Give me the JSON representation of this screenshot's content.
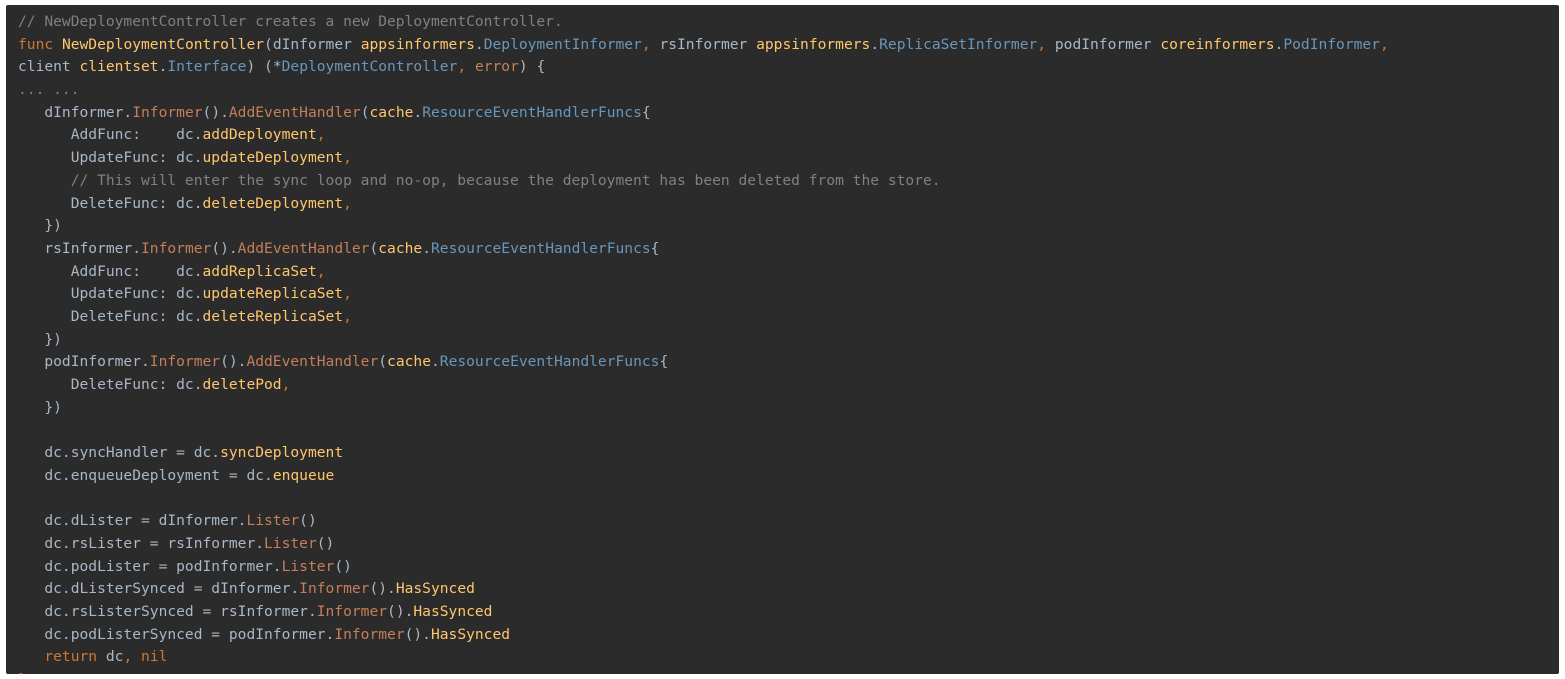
{
  "theme": {
    "background": "#2b2b2b",
    "plain": "#a9b7c6",
    "comment": "#808080",
    "keyword": "#cc7832",
    "function": "#ffc66d",
    "type": "#6897bb",
    "method": "#c57e59"
  },
  "code": {
    "lines": [
      [
        [
          "// NewDeploymentController creates a new DeploymentController.",
          "comment"
        ]
      ],
      [
        [
          "func ",
          "keyword"
        ],
        [
          "NewDeploymentController",
          "function"
        ],
        [
          "(dInformer ",
          "plain"
        ],
        [
          "appsinformers",
          "function"
        ],
        [
          ".",
          "plain"
        ],
        [
          "DeploymentInformer",
          "type"
        ],
        [
          ", ",
          "keyword"
        ],
        [
          "rsInformer ",
          "plain"
        ],
        [
          "appsinformers",
          "function"
        ],
        [
          ".",
          "plain"
        ],
        [
          "ReplicaSetInformer",
          "type"
        ],
        [
          ", ",
          "keyword"
        ],
        [
          "podInformer ",
          "plain"
        ],
        [
          "coreinformers",
          "function"
        ],
        [
          ".",
          "plain"
        ],
        [
          "PodInformer",
          "type"
        ],
        [
          ",",
          "keyword"
        ]
      ],
      [
        [
          "client ",
          "plain"
        ],
        [
          "clientset",
          "function"
        ],
        [
          ".",
          "plain"
        ],
        [
          "Interface",
          "type"
        ],
        [
          ") (*",
          "plain"
        ],
        [
          "DeploymentController",
          "type"
        ],
        [
          ", ",
          "keyword"
        ],
        [
          "error",
          "method"
        ],
        [
          ") {",
          "plain"
        ]
      ],
      [
        [
          "... ...",
          "comment"
        ]
      ],
      [
        [
          "   dInformer.",
          "plain"
        ],
        [
          "Informer",
          "method"
        ],
        [
          "().",
          "plain"
        ],
        [
          "AddEventHandler",
          "method"
        ],
        [
          "(",
          "plain"
        ],
        [
          "cache",
          "function"
        ],
        [
          ".",
          "plain"
        ],
        [
          "ResourceEventHandlerFuncs",
          "type"
        ],
        [
          "{",
          "plain"
        ]
      ],
      [
        [
          "      AddFunc:    dc.",
          "plain"
        ],
        [
          "addDeployment",
          "function"
        ],
        [
          ",",
          "keyword"
        ]
      ],
      [
        [
          "      UpdateFunc: dc.",
          "plain"
        ],
        [
          "updateDeployment",
          "function"
        ],
        [
          ",",
          "keyword"
        ]
      ],
      [
        [
          "      // This will enter the sync loop and no-op, because the deployment has been deleted from the store.",
          "comment"
        ]
      ],
      [
        [
          "      DeleteFunc: dc.",
          "plain"
        ],
        [
          "deleteDeployment",
          "function"
        ],
        [
          ",",
          "keyword"
        ]
      ],
      [
        [
          "   })",
          "plain"
        ]
      ],
      [
        [
          "   rsInformer.",
          "plain"
        ],
        [
          "Informer",
          "method"
        ],
        [
          "().",
          "plain"
        ],
        [
          "AddEventHandler",
          "method"
        ],
        [
          "(",
          "plain"
        ],
        [
          "cache",
          "function"
        ],
        [
          ".",
          "plain"
        ],
        [
          "ResourceEventHandlerFuncs",
          "type"
        ],
        [
          "{",
          "plain"
        ]
      ],
      [
        [
          "      AddFunc:    dc.",
          "plain"
        ],
        [
          "addReplicaSet",
          "function"
        ],
        [
          ",",
          "keyword"
        ]
      ],
      [
        [
          "      UpdateFunc: dc.",
          "plain"
        ],
        [
          "updateReplicaSet",
          "function"
        ],
        [
          ",",
          "keyword"
        ]
      ],
      [
        [
          "      DeleteFunc: dc.",
          "plain"
        ],
        [
          "deleteReplicaSet",
          "function"
        ],
        [
          ",",
          "keyword"
        ]
      ],
      [
        [
          "   })",
          "plain"
        ]
      ],
      [
        [
          "   podInformer.",
          "plain"
        ],
        [
          "Informer",
          "method"
        ],
        [
          "().",
          "plain"
        ],
        [
          "AddEventHandler",
          "method"
        ],
        [
          "(",
          "plain"
        ],
        [
          "cache",
          "function"
        ],
        [
          ".",
          "plain"
        ],
        [
          "ResourceEventHandlerFuncs",
          "type"
        ],
        [
          "{",
          "plain"
        ]
      ],
      [
        [
          "      DeleteFunc: dc.",
          "plain"
        ],
        [
          "deletePod",
          "function"
        ],
        [
          ",",
          "keyword"
        ]
      ],
      [
        [
          "   })",
          "plain"
        ]
      ],
      [
        [
          "",
          "plain"
        ]
      ],
      [
        [
          "   dc.syncHandler = dc.",
          "plain"
        ],
        [
          "syncDeployment",
          "function"
        ]
      ],
      [
        [
          "   dc.enqueueDeployment = dc.",
          "plain"
        ],
        [
          "enqueue",
          "function"
        ]
      ],
      [
        [
          "",
          "plain"
        ]
      ],
      [
        [
          "   dc.dLister = dInformer.",
          "plain"
        ],
        [
          "Lister",
          "method"
        ],
        [
          "()",
          "plain"
        ]
      ],
      [
        [
          "   dc.rsLister = rsInformer.",
          "plain"
        ],
        [
          "Lister",
          "method"
        ],
        [
          "()",
          "plain"
        ]
      ],
      [
        [
          "   dc.podLister = podInformer.",
          "plain"
        ],
        [
          "Lister",
          "method"
        ],
        [
          "()",
          "plain"
        ]
      ],
      [
        [
          "   dc.dListerSynced = dInformer.",
          "plain"
        ],
        [
          "Informer",
          "method"
        ],
        [
          "().",
          "plain"
        ],
        [
          "HasSynced",
          "function"
        ]
      ],
      [
        [
          "   dc.rsListerSynced = rsInformer.",
          "plain"
        ],
        [
          "Informer",
          "method"
        ],
        [
          "().",
          "plain"
        ],
        [
          "HasSynced",
          "function"
        ]
      ],
      [
        [
          "   dc.podListerSynced = podInformer.",
          "plain"
        ],
        [
          "Informer",
          "method"
        ],
        [
          "().",
          "plain"
        ],
        [
          "HasSynced",
          "function"
        ]
      ],
      [
        [
          "   return ",
          "keyword"
        ],
        [
          "dc",
          "plain"
        ],
        [
          ", ",
          "keyword"
        ],
        [
          "nil",
          "keyword"
        ]
      ],
      [
        [
          "}",
          "keyword"
        ]
      ]
    ]
  }
}
